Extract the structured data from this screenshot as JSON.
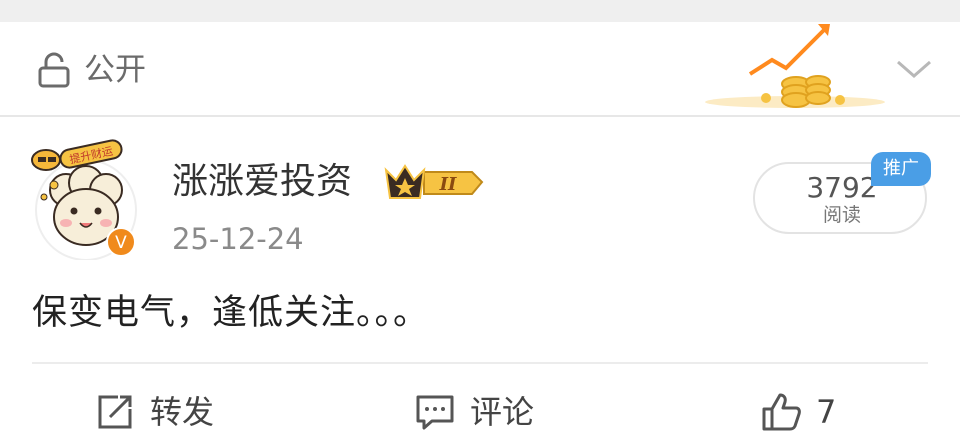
{
  "visibility": {
    "label": "公开",
    "icon": "unlock-icon"
  },
  "post": {
    "author": "涨涨爱投资",
    "badge_level": "II",
    "date": "25-12-24",
    "reads_count": "3792",
    "reads_label": "阅读",
    "promo_tag": "推广",
    "avatar_sticker_text": "提升财运",
    "verified_mark": "V",
    "text": "保变电气，逢低关注。。。"
  },
  "actions": {
    "repost": "转发",
    "comment": "评论",
    "like_count": "7"
  },
  "colors": {
    "promo_blue": "#4a9ee6",
    "verified_orange": "#f08a1c",
    "trend_orange": "#ff8a1e",
    "coin_gold": "#f6c343"
  }
}
